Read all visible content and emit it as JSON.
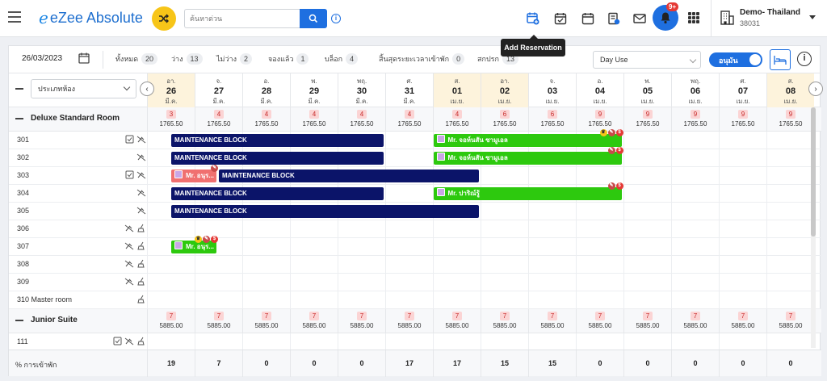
{
  "app": {
    "logo_e": "e",
    "logo_text": "eZee Absolute"
  },
  "search": {
    "placeholder": "ค้นหาด่วน"
  },
  "hotel": {
    "name": "Demo- Thailand",
    "code": "38031"
  },
  "notifications": {
    "count": "9+"
  },
  "tooltip": {
    "text": "Add Reservation"
  },
  "filters": {
    "date": "26/03/2023",
    "stats": [
      {
        "label": "ทั้งหมด",
        "count": "20"
      },
      {
        "label": "ว่าง",
        "count": "13"
      },
      {
        "label": "ไม่ว่าง",
        "count": "2"
      },
      {
        "label": "จองแล้ว",
        "count": "1"
      },
      {
        "label": "บล็อก",
        "count": "4"
      },
      {
        "label": "สิ้นสุดระยะเวลาเข้าพัก",
        "count": "0"
      },
      {
        "label": "สกปรก",
        "count": "13"
      }
    ],
    "dayuse_value": "Day Use",
    "toggle_label": "อนุมัน"
  },
  "grid": {
    "roomtype_select": "ประเภทห้อง",
    "days": [
      {
        "dn": "อา.",
        "dd": "26",
        "dm": "มี.ค.",
        "weekend": true
      },
      {
        "dn": "จ.",
        "dd": "27",
        "dm": "มี.ค.",
        "weekend": false
      },
      {
        "dn": "อ.",
        "dd": "28",
        "dm": "มี.ค.",
        "weekend": false
      },
      {
        "dn": "พ.",
        "dd": "29",
        "dm": "มี.ค.",
        "weekend": false
      },
      {
        "dn": "พฤ.",
        "dd": "30",
        "dm": "มี.ค.",
        "weekend": false
      },
      {
        "dn": "ศ.",
        "dd": "31",
        "dm": "มี.ค.",
        "weekend": false
      },
      {
        "dn": "ส.",
        "dd": "01",
        "dm": "เม.ย.",
        "weekend": true
      },
      {
        "dn": "อา.",
        "dd": "02",
        "dm": "เม.ย.",
        "weekend": true
      },
      {
        "dn": "จ.",
        "dd": "03",
        "dm": "เม.ย.",
        "weekend": false
      },
      {
        "dn": "อ.",
        "dd": "04",
        "dm": "เม.ย.",
        "weekend": false
      },
      {
        "dn": "พ.",
        "dd": "05",
        "dm": "เม.ย.",
        "weekend": false
      },
      {
        "dn": "พฤ.",
        "dd": "06",
        "dm": "เม.ย.",
        "weekend": false
      },
      {
        "dn": "ศ.",
        "dd": "07",
        "dm": "เม.ย.",
        "weekend": false
      },
      {
        "dn": "ส.",
        "dd": "08",
        "dm": "เม.ย.",
        "weekend": true
      }
    ],
    "room_types": [
      {
        "name": "Deluxe Standard Room",
        "avail": [
          "3",
          "4",
          "4",
          "4",
          "4",
          "4",
          "4",
          "6",
          "6",
          "9",
          "9",
          "9",
          "9",
          "9"
        ],
        "rate": "1765.50"
      },
      {
        "name": "Junior Suite",
        "avail": [
          "7",
          "7",
          "7",
          "7",
          "7",
          "7",
          "7",
          "7",
          "7",
          "7",
          "7",
          "7",
          "7",
          "7"
        ],
        "rate": "5885.00"
      }
    ],
    "rooms_deluxe": [
      "301",
      "302",
      "303",
      "304",
      "305",
      "306",
      "307",
      "308",
      "309",
      "310 Master room"
    ],
    "rooms_junior": [
      "111"
    ],
    "bars": [
      {
        "room": 0,
        "start": 0,
        "len": 4.5,
        "type": "maint",
        "text": "MAINTENANCE BLOCK"
      },
      {
        "room": 0,
        "start": 5.5,
        "len": 4,
        "type": "green",
        "text": "Mr. จอห์นสัน ซามูเอล",
        "badges": [
          "crown",
          "note",
          "money"
        ]
      },
      {
        "room": 1,
        "start": 0,
        "len": 4.5,
        "type": "maint",
        "text": "MAINTENANCE BLOCK"
      },
      {
        "room": 1,
        "start": 5.5,
        "len": 4,
        "type": "green",
        "text": "Mr. จอห์นสัน ซามูเอล",
        "badges": [
          "note",
          "money"
        ]
      },
      {
        "room": 2,
        "start": 0,
        "len": 1,
        "type": "red",
        "text": "Mr. อนุร...",
        "badges": [
          "note"
        ]
      },
      {
        "room": 2,
        "start": 1,
        "len": 5.5,
        "type": "maint",
        "text": "MAINTENANCE BLOCK"
      },
      {
        "room": 3,
        "start": 0,
        "len": 4.5,
        "type": "maint",
        "text": "MAINTENANCE BLOCK"
      },
      {
        "room": 3,
        "start": 5.5,
        "len": 4,
        "type": "green",
        "text": "Mr. ปาริณ์รู้",
        "badges": [
          "note",
          "money"
        ]
      },
      {
        "room": 4,
        "start": 0,
        "len": 6.5,
        "type": "maint",
        "text": "MAINTENANCE BLOCK"
      },
      {
        "room": 6,
        "start": 0,
        "len": 1,
        "type": "green",
        "text": "Mr. อนุร...",
        "badges": [
          "crown",
          "note",
          "money"
        ]
      }
    ],
    "occupancy_label": "% การเข้าพัก",
    "occupancy": [
      "19",
      "7",
      "0",
      "0",
      "0",
      "17",
      "17",
      "15",
      "15",
      "0",
      "0",
      "0",
      "0",
      "0"
    ]
  },
  "colors": {
    "accent": "#1e6fe0",
    "maintenance": "#0b1469",
    "reservation": "#2dc90e",
    "arrival": "#f07070",
    "weekend": "#fdf3dc"
  },
  "icons": [
    "hamburger-icon",
    "shuffle-icon",
    "search-icon",
    "info-icon",
    "add-reservation-icon",
    "calendar-check-icon",
    "calendar-icon",
    "invoice-icon",
    "mail-icon",
    "bell-icon",
    "apps-grid-icon",
    "building-icon",
    "bed-icon",
    "checklist-icon",
    "no-housekeeping-icon",
    "broom-icon"
  ]
}
